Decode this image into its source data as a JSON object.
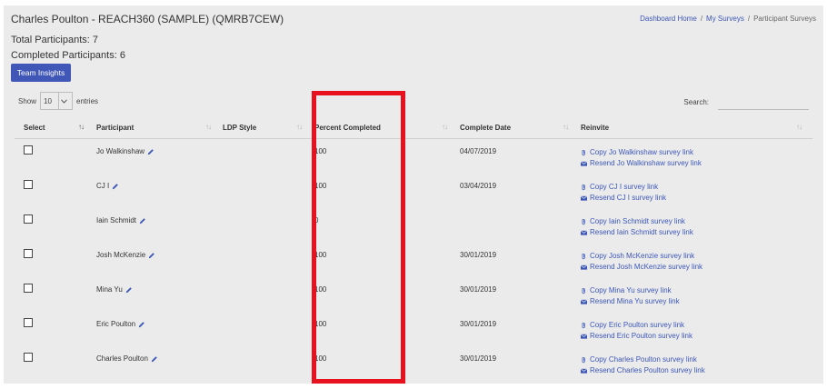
{
  "header": {
    "title": "Charles Poulton - REACH360 (SAMPLE) (QMRB7CEW)",
    "breadcrumb": {
      "home": "Dashboard Home",
      "separator": "/",
      "surveys": "My Surveys",
      "current": "Participant Surveys"
    }
  },
  "stats": {
    "total": "Total Participants: 7",
    "completed": "Completed Participants: 6"
  },
  "team_insights_label": "Team Insights",
  "table_controls": {
    "show_label": "Show",
    "entries_value": "10",
    "entries_label": "entries",
    "search_label": "Search:",
    "search_value": ""
  },
  "columns": [
    "Select",
    "Participant",
    "LDP Style",
    "Percent Completed",
    "Complete Date",
    "Reinvite"
  ],
  "rows": [
    {
      "name": "Jo Walkinshaw",
      "ldp": "",
      "percent": "100",
      "date": "04/07/2019",
      "copy": "Copy Jo Walkinshaw survey link",
      "resend": "Resend Jo Walkinshaw survey link"
    },
    {
      "name": "CJ I",
      "ldp": "",
      "percent": "100",
      "date": "03/04/2019",
      "copy": "Copy CJ I survey link",
      "resend": "Resend CJ I survey link"
    },
    {
      "name": "Iain Schmidt",
      "ldp": "",
      "percent": "0",
      "date": "",
      "copy": "Copy Iain Schmidt survey link",
      "resend": "Resend Iain Schmidt survey link"
    },
    {
      "name": "Josh McKenzie",
      "ldp": "",
      "percent": "100",
      "date": "30/01/2019",
      "copy": "Copy Josh McKenzie survey link",
      "resend": "Resend Josh McKenzie survey link"
    },
    {
      "name": "Mina Yu",
      "ldp": "",
      "percent": "100",
      "date": "30/01/2019",
      "copy": "Copy Mina Yu survey link",
      "resend": "Resend Mina Yu survey link"
    },
    {
      "name": "Eric Poulton",
      "ldp": "",
      "percent": "100",
      "date": "30/01/2019",
      "copy": "Copy Eric Poulton survey link",
      "resend": "Resend Eric Poulton survey link"
    },
    {
      "name": "Charles Poulton",
      "ldp": "",
      "percent": "100",
      "date": "30/01/2019",
      "copy": "Copy Charles Poulton survey link",
      "resend": "Resend Charles Poulton survey link"
    }
  ],
  "colors": {
    "accent": "#4057b8",
    "link": "#3c57b8",
    "highlight": "#e8121f",
    "panel": "#ebebeb"
  }
}
